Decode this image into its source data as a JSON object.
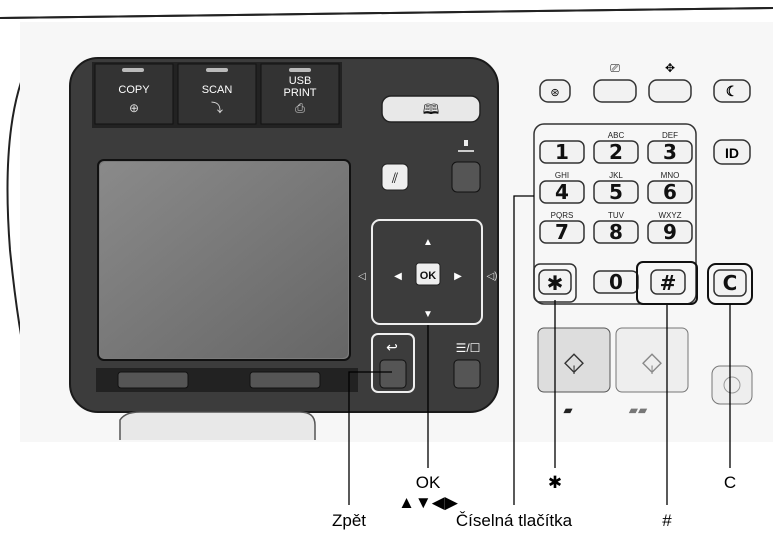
{
  "mode_keys": [
    {
      "label": "COPY"
    },
    {
      "label": "SCAN"
    },
    {
      "label": "USB\nPRINT"
    }
  ],
  "keypad": [
    {
      "digit": "1",
      "letters": ""
    },
    {
      "digit": "2",
      "letters": "ABC"
    },
    {
      "digit": "3",
      "letters": "DEF"
    },
    {
      "digit": "4",
      "letters": "GHI"
    },
    {
      "digit": "5",
      "letters": "JKL"
    },
    {
      "digit": "6",
      "letters": "MNO"
    },
    {
      "digit": "7",
      "letters": "PQRS"
    },
    {
      "digit": "8",
      "letters": "TUV"
    },
    {
      "digit": "9",
      "letters": "WXYZ"
    },
    {
      "digit": "0",
      "letters": ""
    }
  ],
  "special_keys": {
    "star": "✱",
    "hash": "#",
    "clear": "C",
    "id": "ID",
    "ok": "OK"
  },
  "callouts": {
    "ok": "OK",
    "ok_arrows": "▲▼◀▶",
    "back": "Zpět",
    "numeric": "Číselná tlačítka",
    "star": "✱",
    "hash": "#",
    "clear": "C"
  }
}
